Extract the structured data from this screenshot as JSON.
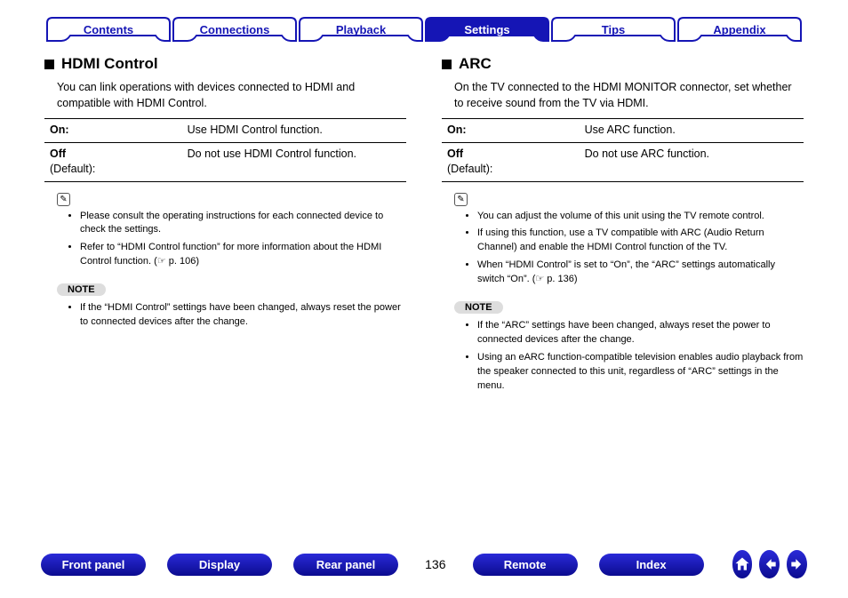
{
  "nav": {
    "tabs": [
      {
        "label": "Contents",
        "active": false
      },
      {
        "label": "Connections",
        "active": false
      },
      {
        "label": "Playback",
        "active": false
      },
      {
        "label": "Settings",
        "active": true
      },
      {
        "label": "Tips",
        "active": false
      },
      {
        "label": "Appendix",
        "active": false
      }
    ]
  },
  "left": {
    "title": "HDMI Control",
    "intro": "You can link operations with devices connected to HDMI and compatible with HDMI Control.",
    "rows": [
      {
        "key": "On:",
        "sub": "",
        "desc": "Use HDMI Control function."
      },
      {
        "key": "Off",
        "sub": "(Default):",
        "desc": "Do not use HDMI Control function."
      }
    ],
    "tips": [
      "Please consult the operating instructions for each connected device to check the settings.",
      "Refer to “HDMI Control function” for more information about the HDMI Control function.  (☞ p. 106)"
    ],
    "note_label": "NOTE",
    "notes": [
      "If the “HDMI Control” settings have been changed, always reset the power to connected devices after the change."
    ]
  },
  "right": {
    "title": "ARC",
    "intro": "On the TV connected to the HDMI MONITOR connector, set whether to receive sound from the TV via HDMI.",
    "rows": [
      {
        "key": "On:",
        "sub": "",
        "desc": "Use ARC function."
      },
      {
        "key": "Off",
        "sub": "(Default):",
        "desc": "Do not use ARC function."
      }
    ],
    "tips": [
      "You can adjust the volume of this unit using the TV remote control.",
      "If using this function, use a TV compatible with ARC (Audio Return Channel) and enable the HDMI Control function of the TV.",
      "When “HDMI Control” is set to “On”, the “ARC” settings automatically switch “On”.  (☞ p. 136)"
    ],
    "note_label": "NOTE",
    "notes": [
      "If the “ARC” settings have been changed, always reset the power to connected devices after the change.",
      "Using an eARC function-compatible television enables audio playback from the speaker connected to this unit, regardless of “ARC” settings in the menu."
    ]
  },
  "bottom": {
    "buttons": [
      "Front panel",
      "Display",
      "Rear panel"
    ],
    "page": "136",
    "buttons2": [
      "Remote",
      "Index"
    ]
  }
}
